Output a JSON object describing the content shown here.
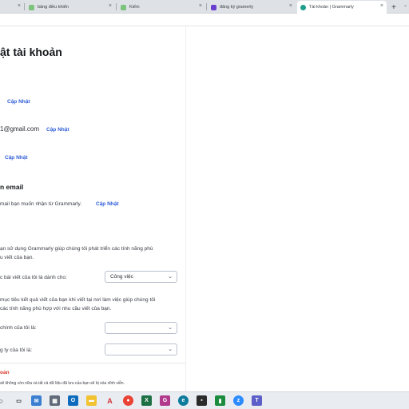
{
  "tabs": [
    {
      "label": "bảng điều khiển",
      "close": "×"
    },
    {
      "label": "Kiếm",
      "close": "×"
    },
    {
      "label": "đăng ký gramerly",
      "close": "×"
    },
    {
      "label": "Tài khoản | Grammarly",
      "close": "×"
    }
  ],
  "new_tab": "+",
  "tab_menu": "⌄",
  "page": {
    "title": "ật tài khoản",
    "update_label_1": "Cập Nhật",
    "email_value": "1@gmail.com",
    "update_label_2": "Cập Nhật",
    "update_label_3": "Cập Nhật",
    "email_section_heading": "n email",
    "email_section_text": "mail bạn muốn nhận từ Grammarly.",
    "update_label_4": "Cập Nhật",
    "personalize_line1": "ạn sử dụng Grammarly giúp chúng tôi phát triển các tính năng phù",
    "personalize_line2": "u viết của bạn.",
    "writing_for_label": "c bài viết của tôi là dành cho:",
    "writing_for_value": "Công việc",
    "goal_line1": "mục tiêu kết quả viết của bạn khi viết tại nơi làm việc giúp chúng tôi",
    "goal_line2": "các tính năng phù hợp với nhu cầu viết của bạn.",
    "main_role_label": "chính của tôi là:",
    "main_role_value": "",
    "company_label": "g ty của tôi là:",
    "company_value": "",
    "delete_heading": "oản",
    "delete_warning": "sẽ không còn nữa và tất cả dữ liệu đã lưu của bạn sẽ bị xóa vĩnh viễn."
  },
  "colors": {
    "accent_link": "#2f5ed7",
    "danger": "#d6372a"
  }
}
